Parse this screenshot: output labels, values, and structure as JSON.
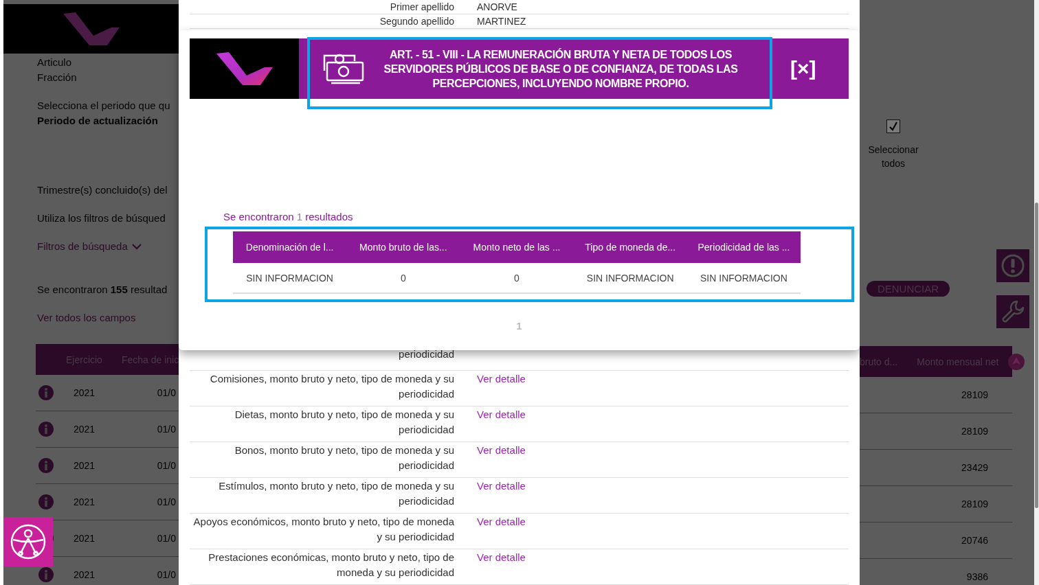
{
  "background_page": {
    "intro_groups": [
      [
        {
          "kind": "text",
          "text": "Articulo"
        },
        {
          "kind": "text",
          "text": "Fracción"
        }
      ],
      [
        {
          "kind": "text",
          "text": "Selecciona el periodo que qu"
        },
        {
          "kind": "strong",
          "text": "Periodo de actualización"
        }
      ],
      [
        {
          "kind": "text",
          "text": "Trimestre(s) concluido(s) del"
        }
      ],
      [
        {
          "kind": "text",
          "text": "Utiliza los filtros de búsqued"
        }
      ],
      [
        {
          "kind": "dropdown",
          "text": "Filtros de búsqueda"
        }
      ],
      [
        {
          "kind": "text",
          "text": "Se encontraron **155** resultad"
        }
      ],
      [
        {
          "kind": "link",
          "text": "Ver todos los campos"
        }
      ]
    ],
    "select_all": {
      "label": "Seleccionar todos",
      "checked": true
    },
    "report_button": "DENUNCIAR",
    "table": {
      "columns_left": [
        "Ejercicio",
        "Fecha de inic"
      ],
      "columns_right": [
        "bruto d...",
        "Monto mensual net"
      ],
      "rows": [
        {
          "year": "2021",
          "start": "01/0",
          "amount": "28109"
        },
        {
          "year": "2021",
          "start": "01/0",
          "amount": "28109"
        },
        {
          "year": "2021",
          "start": "01/0",
          "amount": "23429"
        },
        {
          "year": "2021",
          "start": "01/0",
          "amount": "28109"
        },
        {
          "year": "2021",
          "start": "01/0",
          "amount": "20746"
        },
        {
          "year": "2021",
          "start": "01/0",
          "amount": "9386"
        }
      ]
    }
  },
  "detail_panel": {
    "fields": [
      {
        "label": "Primer apellido",
        "value": "ANORVE"
      },
      {
        "label": "Segundo apellido",
        "value": "MARTINEZ"
      }
    ],
    "rows": [
      {
        "label": "periodicidad"
      },
      {
        "label": "Comisiones, monto bruto y neto, tipo de moneda y su periodicidad",
        "link": "Ver detalle"
      },
      {
        "label": "Dietas, monto bruto y neto, tipo de moneda y su periodicidad",
        "link": "Ver detalle"
      },
      {
        "label": "Bonos, monto bruto y neto, tipo de moneda y su periodicidad",
        "link": "Ver detalle"
      },
      {
        "label": "Estímulos, monto bruto y neto, tipo de moneda y su periodicidad",
        "link": "Ver detalle"
      },
      {
        "label": "Apoyos económicos, monto bruto y neto, tipo de moneda y su periodicidad",
        "link": "Ver detalle"
      },
      {
        "label": "Prestaciones económicas, monto bruto y neto, tipo de moneda y su periodicidad",
        "link": "Ver detalle"
      }
    ]
  },
  "modal": {
    "title": "ART. - 51 - VIII - LA REMUNERACIÓN BRUTA Y NETA DE TODOS LOS SERVIDORES PÚBLICOS DE BASE O DE CONFIANZA, DE TODAS LAS PERCEPCIONES, INCLUYENDO NOMBRE PROPIO.",
    "close": "[×]",
    "results": {
      "prefix": "Se encontraron",
      "count": "1",
      "suffix": "resultados"
    },
    "table": {
      "columns": [
        "Denominación de l...",
        "Monto bruto de las...",
        "Monto neto de las ...",
        "Tipo de moneda de...",
        "Periodicidad de las ..."
      ],
      "rows": [
        [
          "SIN INFORMACION",
          "0",
          "0",
          "SIN INFORMACION",
          "SIN INFORMACION"
        ]
      ]
    },
    "pagination": [
      "1"
    ]
  }
}
